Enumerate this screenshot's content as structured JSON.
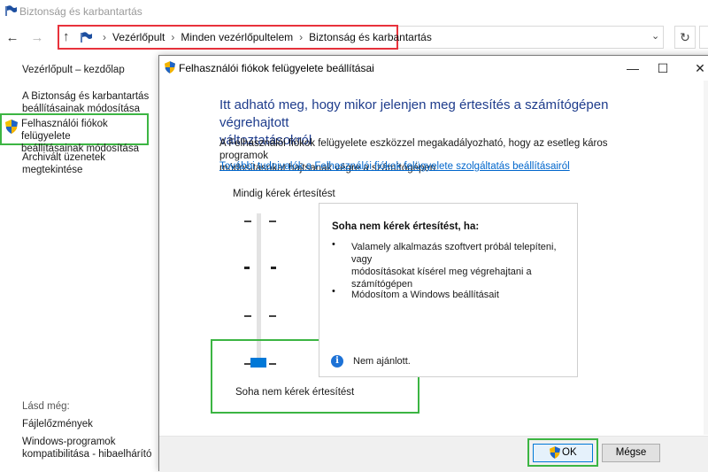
{
  "window": {
    "title": "Biztonság és karbantartás"
  },
  "nav": {
    "back_icon": "arrow-left-icon",
    "forward_icon": "arrow-right-icon",
    "up_icon": "arrow-up-icon",
    "breadcrumbs": [
      "Vezérlőpult",
      "Minden vezérlőpultelem",
      "Biztonság és karbantartás"
    ],
    "separator": "›",
    "back": "←",
    "forward": "→",
    "up": "↑",
    "dropdown": "⌄",
    "refresh": "↻"
  },
  "sidebar": {
    "home": "Vezérlőpult – kezdőlap",
    "items": [
      {
        "label_line1": "A Biztonság és karbantartás",
        "label_line2": "beállításainak módosítása"
      },
      {
        "label_line1": "Felhasználói fiókok felügyelete",
        "label_line2": "beállításainak módosítása"
      },
      {
        "label_line1": "Archivált üzenetek",
        "label_line2": "megtekintése"
      }
    ],
    "see_also": "Lásd még:",
    "see_also_links": [
      {
        "label_line1": "Fájlelőzmények",
        "label_line2": ""
      },
      {
        "label_line1": "Windows-programok",
        "label_line2": "kompatibilitása - hibaelhárító"
      }
    ]
  },
  "dialog": {
    "title": "Felhasználói fiókok felügyelete beállításai",
    "minimize": "—",
    "maximize": "☐",
    "close": "✕",
    "heading_line1": "Itt adható meg, hogy mikor jelenjen meg értesítés a számítógépen végrehajtott",
    "heading_line2": "változtatásokról",
    "desc_line1": "A Felhasználói fiókok felügyelete eszközzel megakadályozható, hogy az esetleg káros programok",
    "desc_line2": "módosításokat hajtsanak végre a számítógépen.",
    "more_link": "További tudnivalók a Felhasználói fiókok felügyelete szolgáltatás beállításairól",
    "slider_top_label": "Mindig kérek értesítést",
    "slider_bottom_label": "Soha nem kérek értesítést",
    "slider": {
      "levels": 4,
      "selected_level": 1
    },
    "panel": {
      "heading": "Soha nem kérek értesítést, ha:",
      "bullets": [
        {
          "line1": "Valamely alkalmazás szoftvert próbál telepíteni, vagy",
          "line2": "módosításokat kísérel meg végrehajtani a",
          "line3": "számítógépen"
        },
        {
          "line1": "Módosítom a Windows beállításait",
          "line2": "",
          "line3": ""
        }
      ],
      "bullet_glyph": "•",
      "info_glyph": "i",
      "note": "Nem ajánlott."
    },
    "ok_label": "OK",
    "cancel_label": "Mégse"
  },
  "colors": {
    "heading": "#1e3c8c",
    "link": "#0066cc",
    "highlight_red": "#e8323c",
    "highlight_green": "#3cb543",
    "slider_thumb": "#0078d7"
  }
}
